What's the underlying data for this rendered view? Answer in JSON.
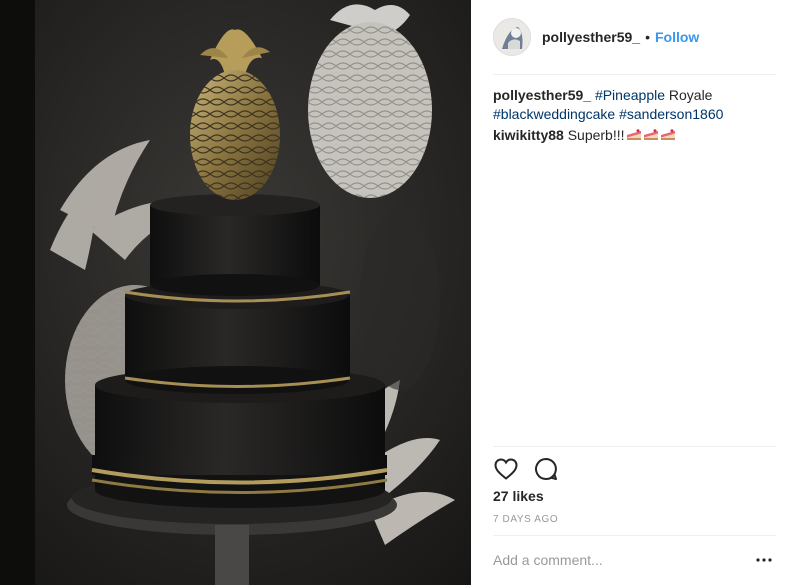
{
  "post": {
    "author": "pollyesther59_",
    "separator": "•",
    "follow_label": "Follow",
    "avatar_icon": "profile-avatar-icon"
  },
  "comments": [
    {
      "user": "pollyesther59_",
      "parts": [
        {
          "type": "hashtag",
          "text": "#Pineapple"
        },
        {
          "type": "text",
          "text": " Royale "
        },
        {
          "type": "hashtag",
          "text": "#blackweddingcake"
        },
        {
          "type": "text",
          "text": " "
        },
        {
          "type": "hashtag",
          "text": "#sanderson1860"
        }
      ]
    },
    {
      "user": "kiwikitty88",
      "text": "Superb!!!",
      "emoji_count": 3,
      "emoji_icon": "cake-slice-emoji-icon"
    }
  ],
  "actions": {
    "like_icon": "heart-icon",
    "comment_icon": "comment-bubble-icon",
    "more_icon": "more-dots-icon"
  },
  "likes_text": "27 likes",
  "time_text": "7 DAYS AGO",
  "add_comment_placeholder": "Add a comment...",
  "colors": {
    "follow": "#3897f0",
    "hashtag": "#003569",
    "text": "#262626",
    "muted": "#999999",
    "divider": "#efefef"
  }
}
